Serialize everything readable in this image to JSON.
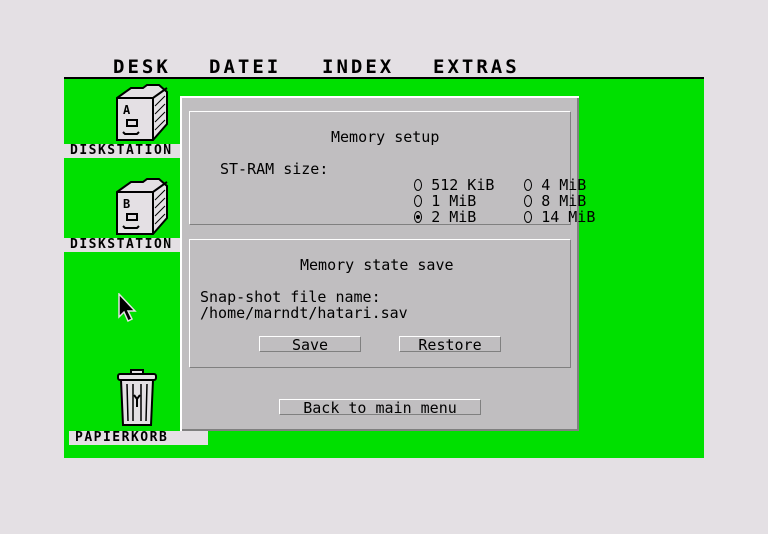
{
  "menubar": {
    "items": [
      {
        "label": "DESK"
      },
      {
        "label": "DATEI"
      },
      {
        "label": "INDEX"
      },
      {
        "label": "EXTRAS"
      }
    ]
  },
  "desktop": {
    "background_color": "#00e000",
    "icons": [
      {
        "type": "floppy-drive",
        "letter": "A",
        "label": "DISKSTATION"
      },
      {
        "type": "floppy-drive",
        "letter": "B",
        "label": "DISKSTATION"
      },
      {
        "type": "trash-can",
        "label": "PAPIERKORB"
      }
    ]
  },
  "dialog": {
    "memory_setup": {
      "title": "Memory setup",
      "st_ram_label": "ST-RAM size:",
      "options": [
        {
          "label": "512 KiB",
          "selected": false
        },
        {
          "label": "1 MiB",
          "selected": false
        },
        {
          "label": "2 MiB",
          "selected": true
        },
        {
          "label": "4 MiB",
          "selected": false
        },
        {
          "label": "8 MiB",
          "selected": false
        },
        {
          "label": "14 MiB",
          "selected": false
        }
      ]
    },
    "state_save": {
      "title": "Memory state save",
      "file_label": "Snap-shot file name:",
      "file_path": "/home/marndt/hatari.sav",
      "save_label": "Save",
      "restore_label": "Restore"
    },
    "back_label": "Back to main menu"
  }
}
